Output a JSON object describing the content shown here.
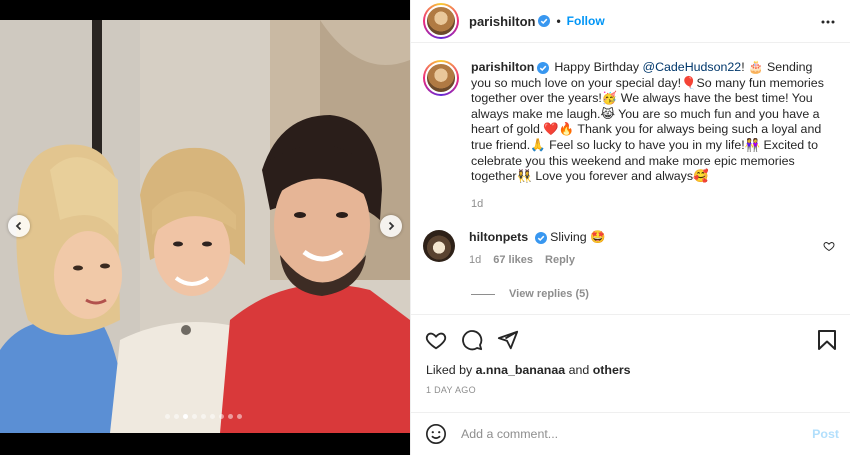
{
  "post": {
    "username": "parishilton",
    "separator": "•",
    "follow_label": "Follow",
    "media": {
      "slide_count": 9,
      "active_slide": 3
    }
  },
  "caption": {
    "username": "parishilton",
    "text_before_mention": "Happy Birthday ",
    "mention": "@CadeHudson22",
    "text_after_mention": "! 🎂 Sending you so much love on your special day!🎈So many fun memories together over the years!🥳 We always have the best time! You always make me laugh.😹 You are so much fun and you have a heart of gold.❤️🔥 Thank you for always being such a loyal and true friend.🙏 Feel so lucky to have you in my life!👭 Excited to celebrate you this weekend and make more epic memories together👯‍♀️ Love you forever and always🥰",
    "time": "1d"
  },
  "comment": {
    "username": "hiltonpets",
    "text": "Sliving 🤩",
    "time": "1d",
    "likes": "67 likes",
    "reply_label": "Reply",
    "view_replies": "View replies (5)"
  },
  "engagement": {
    "liked_by_prefix": "Liked by ",
    "liked_by_user": "a.nna_bananaa",
    "liked_by_and": " and ",
    "liked_by_others": "others",
    "ago": "1 DAY AGO"
  },
  "composer": {
    "placeholder": "Add a comment...",
    "post_label": "Post"
  },
  "icons": {
    "verified": "verified-badge-icon",
    "more": "more-options-icon",
    "like": "heart-icon",
    "comment": "comment-bubble-icon",
    "share": "paper-plane-icon",
    "save": "bookmark-icon",
    "emoji": "emoji-smiley-icon",
    "prev": "chevron-left-icon",
    "next": "chevron-right-icon"
  },
  "colors": {
    "accent": "#0095f6",
    "verified": "#3897f0",
    "muted": "#8e8e8e",
    "post_disabled": "#b2dffc",
    "mention": "#00376b"
  }
}
